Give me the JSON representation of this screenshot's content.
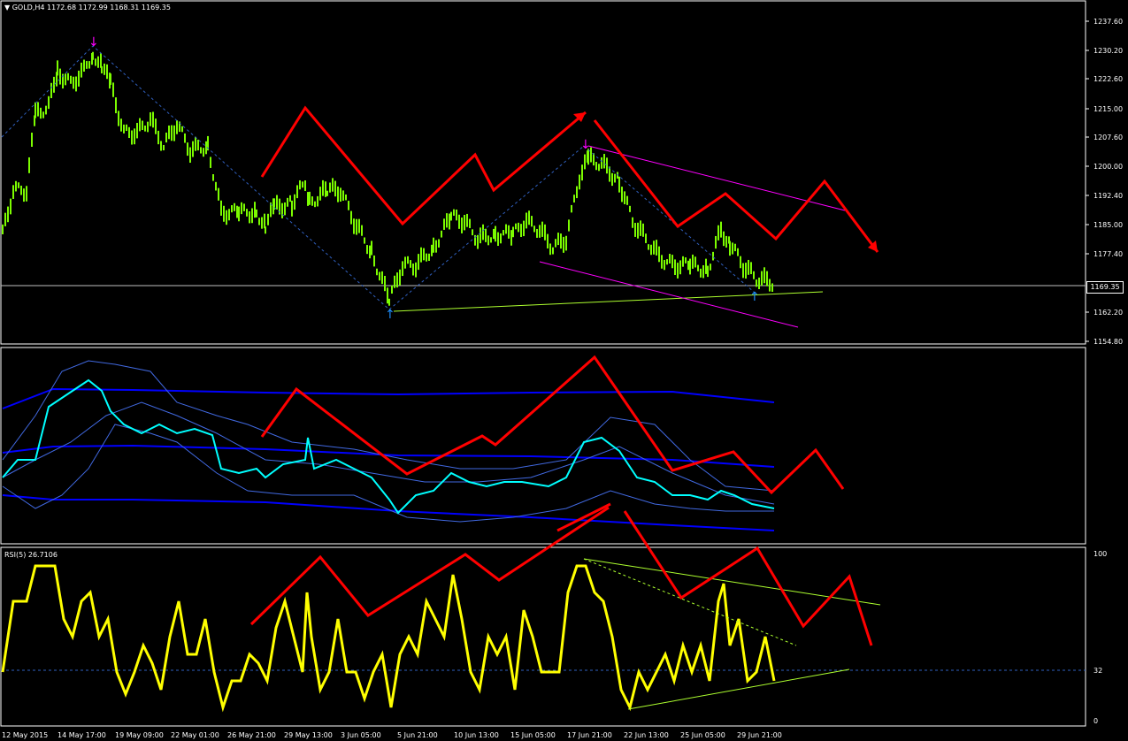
{
  "header": {
    "symbol": "GOLD,H4",
    "ohlc": "1172.68 1172.99 1168.31 1169.35",
    "menu_icon": "triangle-down-icon"
  },
  "price_axis": {
    "labels": [
      "1237.60",
      "1230.20",
      "1222.60",
      "1215.00",
      "1207.60",
      "1200.00",
      "1192.40",
      "1185.00",
      "1177.40",
      "1169.80",
      "1162.20",
      "1154.80"
    ],
    "current_price": "1169.35"
  },
  "rsi": {
    "title": "RSI(5) 26.7106",
    "levels": [
      "100",
      "32",
      "0"
    ]
  },
  "time_axis": {
    "labels": [
      "12 May 2015",
      "14 May 17:00",
      "19 May 09:00",
      "22 May 01:00",
      "26 May 21:00",
      "29 May 13:00",
      "3 Jun 05:00",
      "5 Jun 21:00",
      "10 Jun 13:00",
      "15 Jun 05:00",
      "17 Jun 21:00",
      "22 Jun 13:00",
      "25 Jun 05:00",
      "29 Jun 21:00"
    ]
  },
  "colors": {
    "background": "#000000",
    "candles": "#7CFC00",
    "arrows": "#FF0000",
    "rsi_line": "#FFFF00",
    "bands": "#0000FF",
    "cyan_line": "#00FFFF",
    "channel": "#FF00FF"
  }
}
